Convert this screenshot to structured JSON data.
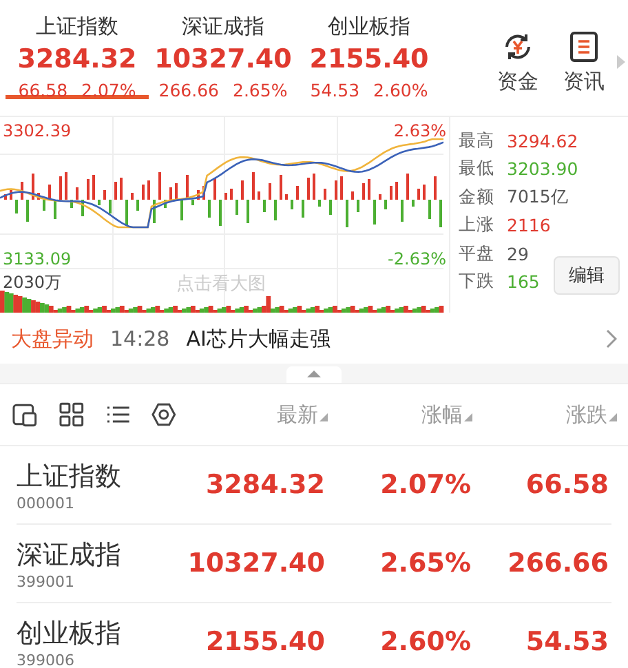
{
  "index_tabs": [
    {
      "name": "上证指数",
      "price": "3284.32",
      "change": "66.58",
      "percent": "2.07%",
      "selected": true
    },
    {
      "name": "深证成指",
      "price": "10327.40",
      "change": "266.66",
      "percent": "2.65%",
      "selected": false
    },
    {
      "name": "创业板指",
      "price": "2155.40",
      "change": "54.53",
      "percent": "2.60%",
      "selected": false
    }
  ],
  "quick_buttons": [
    {
      "label": "资金",
      "kind": "fund"
    },
    {
      "label": "资讯",
      "kind": "news"
    }
  ],
  "chart": {
    "top_price": "3302.39",
    "top_percent": "2.63%",
    "bottom_price": "3133.09",
    "bottom_percent": "-2.63%",
    "volume": "2030万",
    "hint": "点击看大图"
  },
  "stats": [
    {
      "label": "最高",
      "value": "3294.62",
      "color": "#e03a2f"
    },
    {
      "label": "最低",
      "value": "3203.90",
      "color": "#4caf32"
    },
    {
      "label": "金额",
      "value": "7015亿",
      "color": "#555555"
    },
    {
      "label": "上涨",
      "value": "2116",
      "color": "#e03a2f"
    },
    {
      "label": "平盘",
      "value": "29",
      "color": "#555555"
    },
    {
      "label": "下跌",
      "value": "165",
      "color": "#4caf32"
    }
  ],
  "edit_button": "编辑",
  "news": {
    "tag": "大盘异动",
    "time": "14:28",
    "headline": "AI芯片大幅走强"
  },
  "columns": [
    "最新",
    "涨幅",
    "涨跌"
  ],
  "rows": [
    {
      "name": "上证指数",
      "code": "000001",
      "price": "3284.32",
      "percent": "2.07%",
      "change": "66.58"
    },
    {
      "name": "深证成指",
      "code": "399001",
      "price": "10327.40",
      "percent": "2.65%",
      "change": "266.66"
    },
    {
      "name": "创业板指",
      "code": "399006",
      "price": "2155.40",
      "percent": "2.60%",
      "change": "54.53"
    }
  ]
}
